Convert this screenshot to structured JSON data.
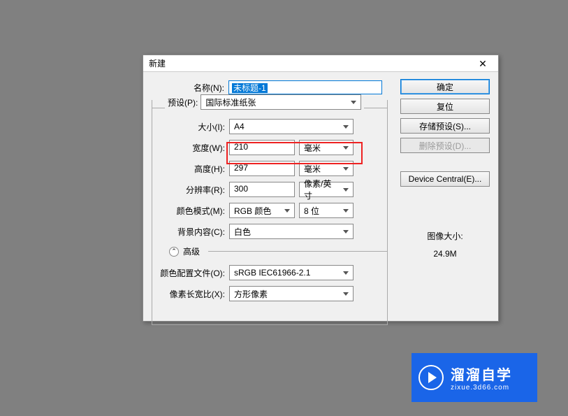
{
  "dialog": {
    "title": "新建",
    "close": "✕"
  },
  "fields": {
    "name_label": "名称(N):",
    "name_value": "未标题-1",
    "preset_label": "预设(P):",
    "preset_value": "国际标准纸张",
    "size_label": "大小(I):",
    "size_value": "A4",
    "width_label": "宽度(W):",
    "width_value": "210",
    "width_unit": "毫米",
    "height_label": "高度(H):",
    "height_value": "297",
    "height_unit": "毫米",
    "resolution_label": "分辨率(R):",
    "resolution_value": "300",
    "resolution_unit": "像素/英寸",
    "colormode_label": "颜色模式(M):",
    "colormode_value": "RGB 颜色",
    "colordepth_value": "8 位",
    "background_label": "背景内容(C):",
    "background_value": "白色",
    "advanced_label": "高级",
    "profile_label": "颜色配置文件(O):",
    "profile_value": "sRGB IEC61966-2.1",
    "pixelratio_label": "像素长宽比(X):",
    "pixelratio_value": "方形像素"
  },
  "buttons": {
    "ok": "确定",
    "reset": "复位",
    "save_preset": "存储预设(S)...",
    "delete_preset": "删除预设(D)...",
    "device_central": "Device Central(E)..."
  },
  "image_size": {
    "label": "图像大小:",
    "value": "24.9M"
  },
  "watermark": {
    "main": "溜溜自学",
    "sub": "zixue.3d66.com"
  }
}
